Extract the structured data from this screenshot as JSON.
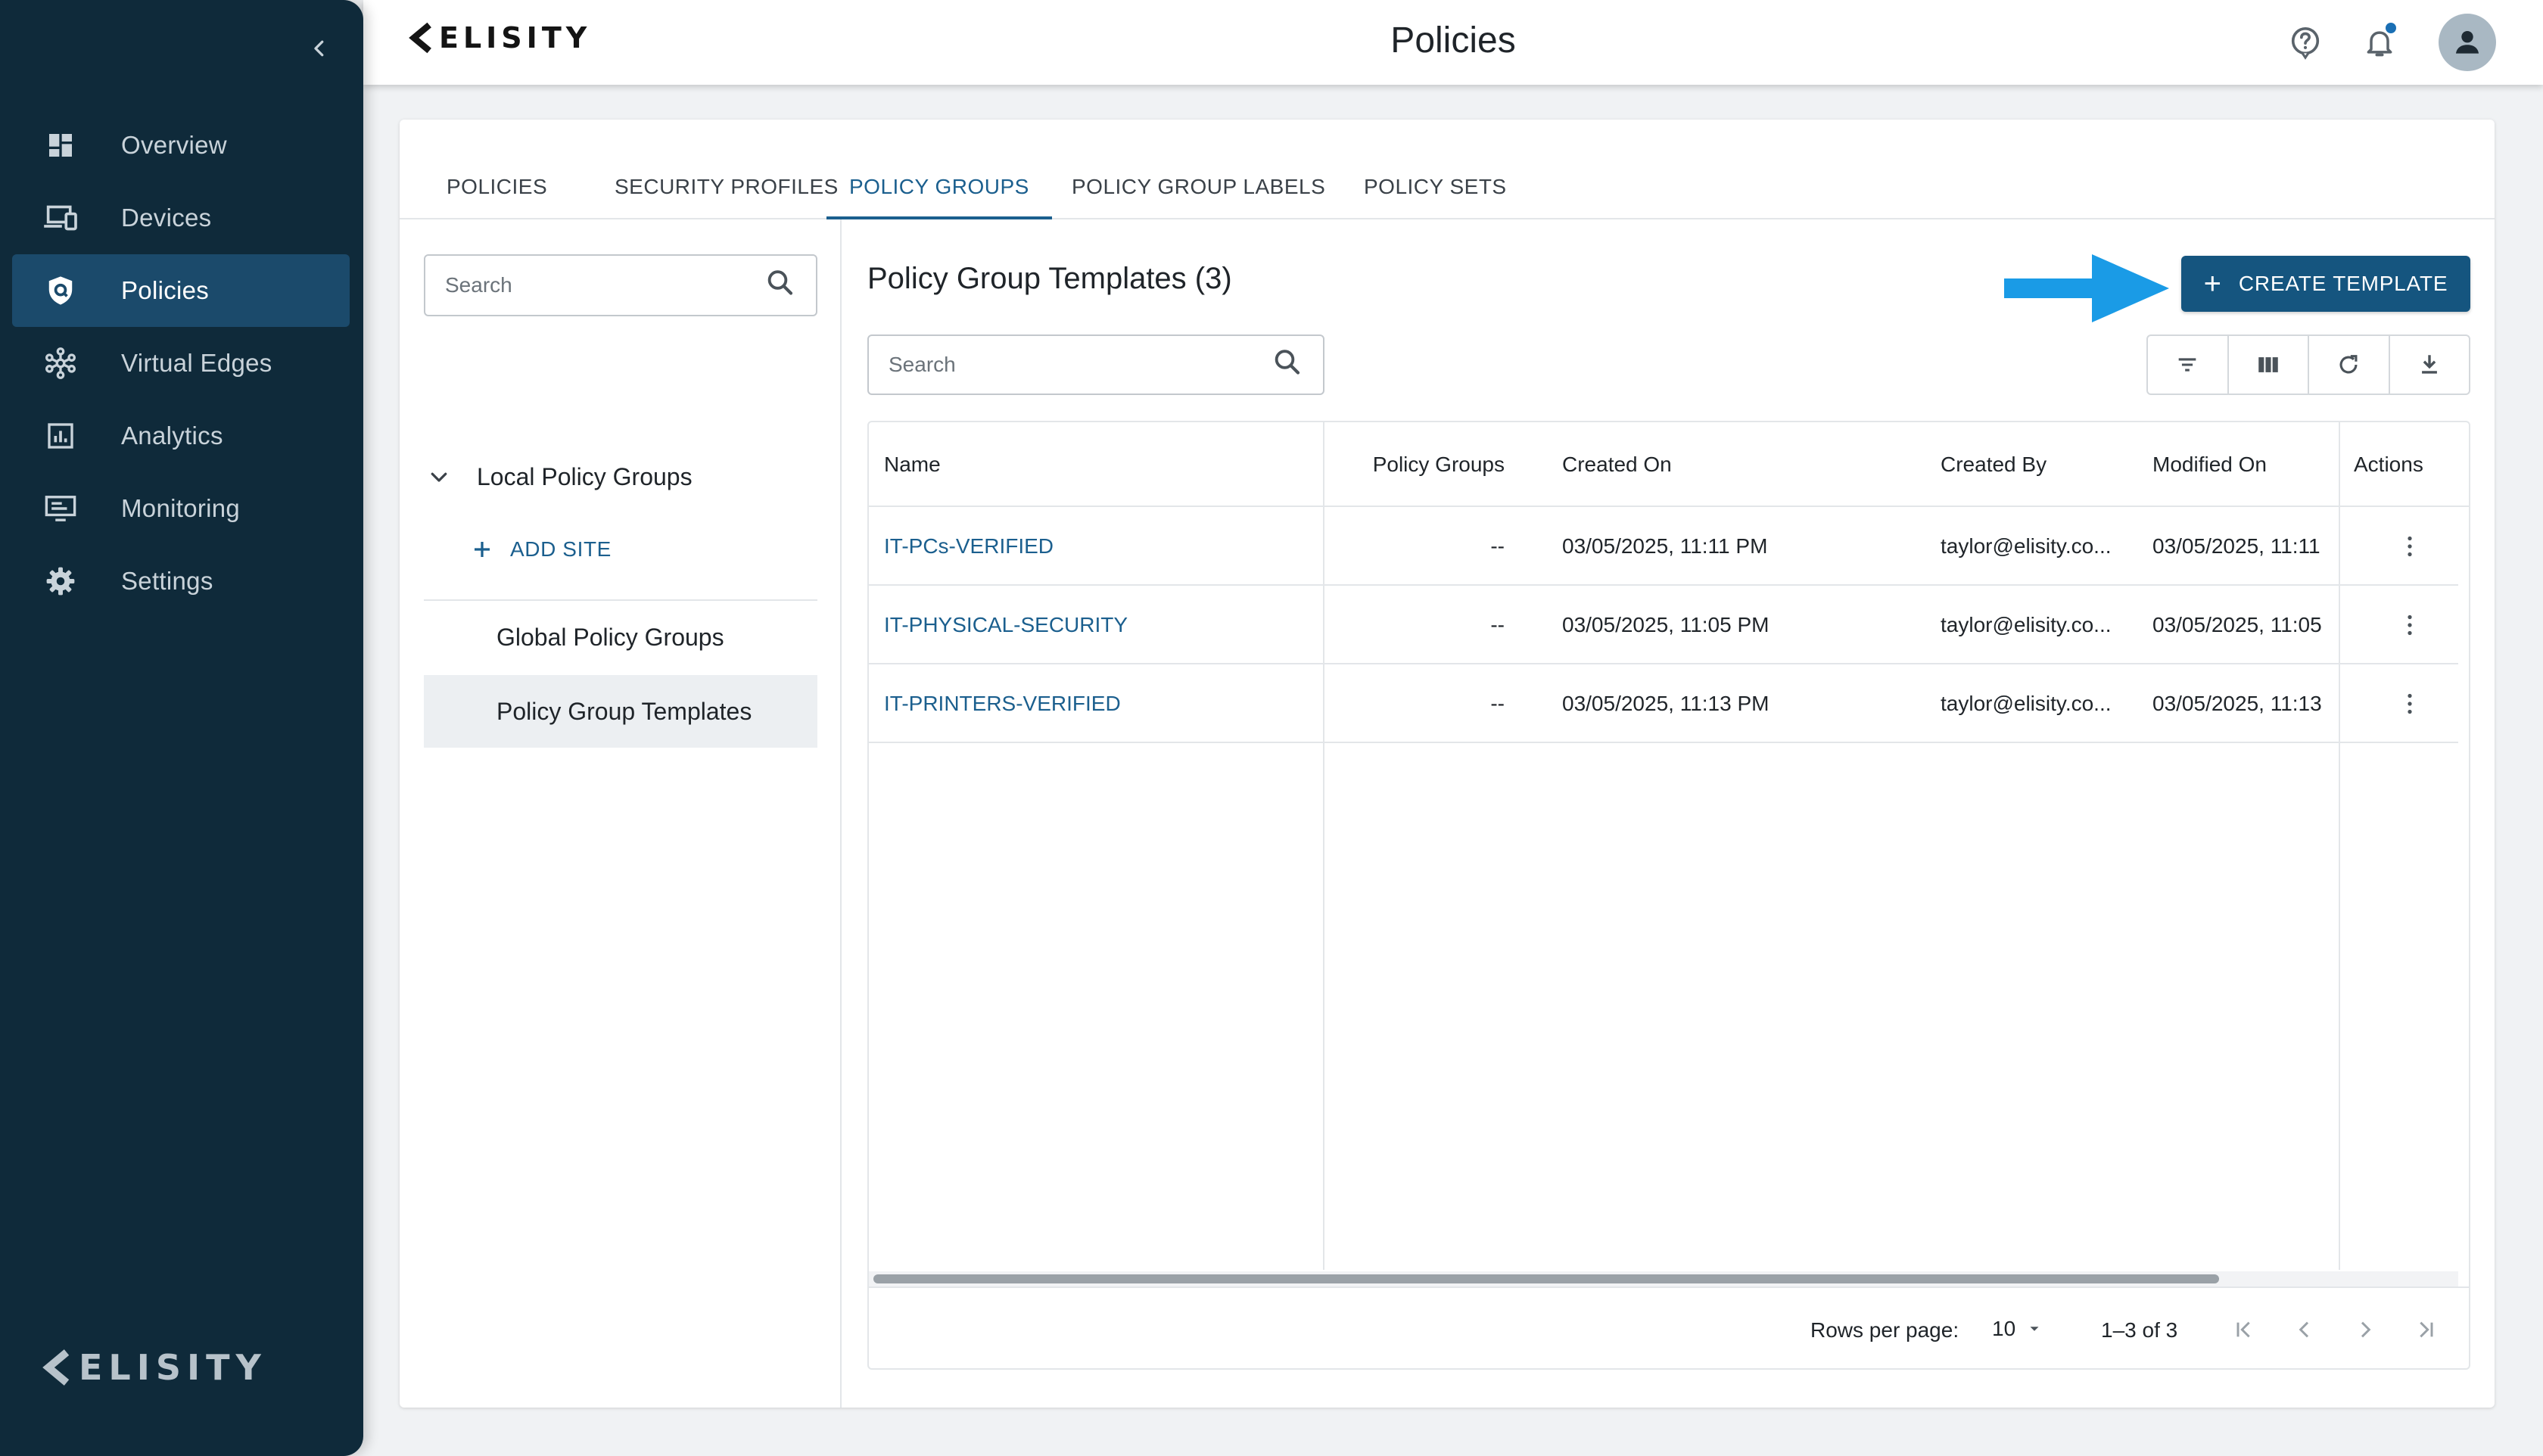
{
  "app": {
    "brand": "ELISITY",
    "page_title": "Policies",
    "accent": "#15557f",
    "sidebar_bg": "#0f2a3a"
  },
  "sidebar": {
    "collapse_icon": "chevron-left-icon",
    "items": [
      {
        "label": "Overview",
        "icon": "dashboard-icon",
        "active": false
      },
      {
        "label": "Devices",
        "icon": "devices-icon",
        "active": false
      },
      {
        "label": "Policies",
        "icon": "shield-icon",
        "active": true
      },
      {
        "label": "Virtual Edges",
        "icon": "network-icon",
        "active": false
      },
      {
        "label": "Analytics",
        "icon": "analytics-icon",
        "active": false
      },
      {
        "label": "Monitoring",
        "icon": "monitor-icon",
        "active": false
      },
      {
        "label": "Settings",
        "icon": "gear-icon",
        "active": false
      }
    ]
  },
  "topbar": {
    "icons": [
      "help-icon",
      "bell-icon",
      "avatar-icon"
    ]
  },
  "tabs": [
    {
      "label": "POLICIES",
      "active": false
    },
    {
      "label": "SECURITY PROFILES",
      "active": false
    },
    {
      "label": "POLICY GROUPS",
      "active": true
    },
    {
      "label": "POLICY GROUP LABELS",
      "active": false
    },
    {
      "label": "POLICY SETS",
      "active": false
    }
  ],
  "left_panel": {
    "search_placeholder": "Search",
    "tree_root": "Local Policy Groups",
    "add_site_label": "ADD SITE",
    "items": [
      {
        "label": "Global Policy Groups",
        "selected": false
      },
      {
        "label": "Policy Group Templates",
        "selected": true
      }
    ]
  },
  "main": {
    "title": "Policy Group Templates (3)",
    "create_button": "CREATE TEMPLATE",
    "search_placeholder": "Search",
    "toolbar_icons": [
      "filter-icon",
      "columns-icon",
      "refresh-icon",
      "download-icon"
    ],
    "columns": [
      "Name",
      "Policy Groups",
      "Created On",
      "Created By",
      "Modified On",
      "Actions"
    ],
    "rows": [
      {
        "name": "IT-PCs-VERIFIED",
        "policy_groups": "--",
        "created_on": "03/05/2025, 11:11 PM",
        "created_by": "taylor@elisity.co...",
        "modified_on": "03/05/2025, 11:11"
      },
      {
        "name": "IT-PHYSICAL-SECURITY",
        "policy_groups": "--",
        "created_on": "03/05/2025, 11:05 PM",
        "created_by": "taylor@elisity.co...",
        "modified_on": "03/05/2025, 11:05"
      },
      {
        "name": "IT-PRINTERS-VERIFIED",
        "policy_groups": "--",
        "created_on": "03/05/2025, 11:13 PM",
        "created_by": "taylor@elisity.co...",
        "modified_on": "03/05/2025, 11:13"
      }
    ],
    "pagination": {
      "rows_per_page_label": "Rows per page:",
      "rows_per_page": "10",
      "range": "1–3 of 3"
    }
  }
}
